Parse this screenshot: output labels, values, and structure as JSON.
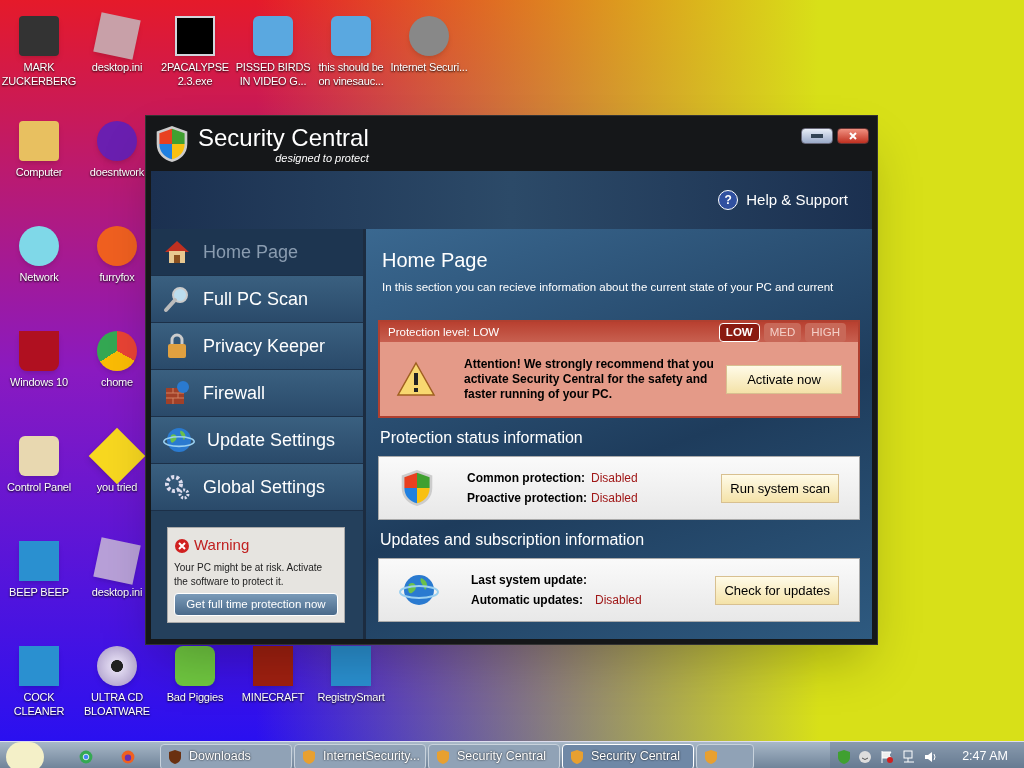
{
  "desktop": {
    "icon_rows": [
      [
        {
          "label": "MARK ZUCKERBERG"
        },
        {
          "label": "desktop.ini"
        },
        {
          "label": "2PACALYPSE 2.3.exe"
        },
        {
          "label": "PISSED BIRDS IN VIDEO G..."
        },
        {
          "label": "this should be on vinesauc..."
        },
        {
          "label": "Internet Securi..."
        }
      ],
      [
        {
          "label": "Computer"
        },
        {
          "label": "doesntwork"
        }
      ],
      [
        {
          "label": "Network"
        },
        {
          "label": "furryfox"
        }
      ],
      [
        {
          "label": "Windows 10"
        },
        {
          "label": "chome"
        }
      ],
      [
        {
          "label": "Control Panel"
        },
        {
          "label": "you tried"
        }
      ],
      [
        {
          "label": "BEEP BEEP"
        },
        {
          "label": "desktop.ini"
        }
      ],
      [
        {
          "label": "COCK CLEANER"
        },
        {
          "label": "ULTRA CD BLOATWARE"
        },
        {
          "label": "Bad Piggies"
        },
        {
          "label": "MINECRAFT"
        },
        {
          "label": "RegistrySmart"
        }
      ]
    ]
  },
  "window": {
    "title": "Security Central",
    "subtitle": "designed to protect",
    "help": "Help & Support",
    "help_icon": "?",
    "nav": [
      {
        "label": "Home Page",
        "selected": true
      },
      {
        "label": "Full PC Scan",
        "selected": false
      },
      {
        "label": "Privacy Keeper",
        "selected": false
      },
      {
        "label": "Firewall",
        "selected": false
      },
      {
        "label": "Update Settings",
        "selected": false
      },
      {
        "label": "Global Settings",
        "selected": false
      }
    ],
    "warning": {
      "title": "Warning",
      "text": "Your PC might be at risk. Activate the software to protect it.",
      "button": "Get full time protection now"
    },
    "page": {
      "title": "Home Page",
      "intro": "In this section you can recieve information about the current state of your PC and current",
      "protection": {
        "label": "Protection level: LOW",
        "levels": [
          {
            "label": "LOW",
            "selected": true
          },
          {
            "label": "MED",
            "selected": false
          },
          {
            "label": "HIGH",
            "selected": false
          }
        ],
        "message": "Attention! We strongly recommend that you activate Security Central for the safety and faster running of your PC.",
        "button": "Activate now"
      },
      "sections": [
        {
          "heading": "Protection status information",
          "rows": [
            {
              "label": "Common protection:",
              "value": "Disabled"
            },
            {
              "label": "Proactive protection:",
              "value": "Disabled"
            }
          ],
          "button": "Run system scan"
        },
        {
          "heading": "Updates and subscription information",
          "rows": [
            {
              "label": "Last system update:"
            },
            {
              "label": "Automatic updates:",
              "value": "Disabled"
            }
          ],
          "button": "Check for updates"
        }
      ]
    }
  },
  "taskbar": {
    "tasks": [
      {
        "label": "Downloads",
        "selected": false
      },
      {
        "label": "InternetSecurity...",
        "selected": false
      },
      {
        "label": "Security Central",
        "selected": false
      },
      {
        "label": "Security Central",
        "selected": true
      },
      {
        "kind": "icon",
        "selected": false
      }
    ],
    "clock": "2:47 AM"
  }
}
